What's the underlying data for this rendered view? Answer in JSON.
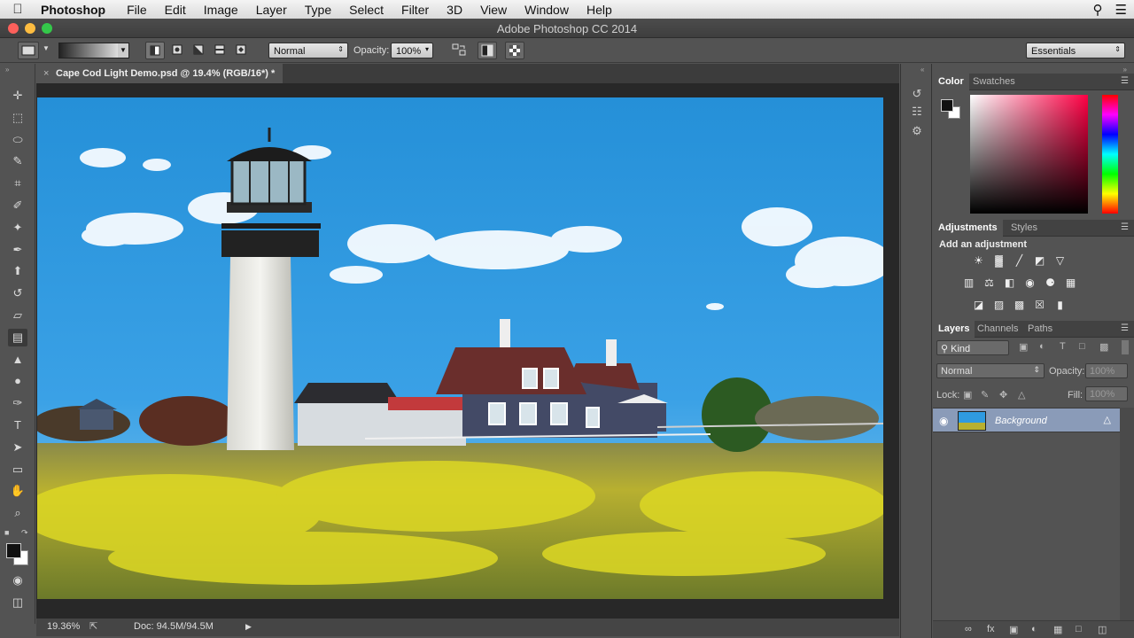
{
  "menubar": {
    "app_name": "Photoshop",
    "items": [
      "File",
      "Edit",
      "Image",
      "Layer",
      "Type",
      "Select",
      "Filter",
      "3D",
      "View",
      "Window",
      "Help"
    ]
  },
  "window": {
    "title": "Adobe Photoshop CC 2014"
  },
  "options_bar": {
    "mode_value": "Normal",
    "opacity_label": "Opacity:",
    "opacity_value": "100%",
    "workspace_value": "Essentials"
  },
  "document": {
    "tab_title": "Cape Cod Light Demo.psd @ 19.4% (RGB/16*) *",
    "zoom": "19.36%",
    "doc_size": "Doc: 94.5M/94.5M"
  },
  "tools": {
    "icons": [
      "move-tool-icon",
      "marquee-tool-icon",
      "lasso-tool-icon",
      "quick-selection-tool-icon",
      "crop-tool-icon",
      "eyedropper-tool-icon",
      "healing-brush-tool-icon",
      "brush-tool-icon",
      "clone-stamp-tool-icon",
      "history-brush-tool-icon",
      "eraser-tool-icon",
      "gradient-tool-icon",
      "blur-tool-icon",
      "dodge-tool-icon",
      "pen-tool-icon",
      "type-tool-icon",
      "path-selection-tool-icon",
      "rectangle-tool-icon",
      "hand-tool-icon",
      "zoom-tool-icon"
    ],
    "foreground_color": "#111111",
    "background_color": "#ffffff"
  },
  "color_panel": {
    "tabs": [
      "Color",
      "Swatches"
    ]
  },
  "adjustments_panel": {
    "tabs": [
      "Adjustments",
      "Styles"
    ],
    "heading": "Add an adjustment"
  },
  "layers_panel": {
    "tabs": [
      "Layers",
      "Channels",
      "Paths"
    ],
    "filter_value": "Kind",
    "blend_mode": "Normal",
    "opacity_label": "Opacity:",
    "opacity_value": "100%",
    "lock_label": "Lock:",
    "fill_label": "Fill:",
    "fill_value": "100%",
    "layers": [
      {
        "name": "Background",
        "visible": true,
        "locked": true,
        "selected": true
      }
    ]
  },
  "colors": {
    "ui_gray": "#535353",
    "selected_layer": "#8a9bb8",
    "sky": "#2f9ae0"
  }
}
